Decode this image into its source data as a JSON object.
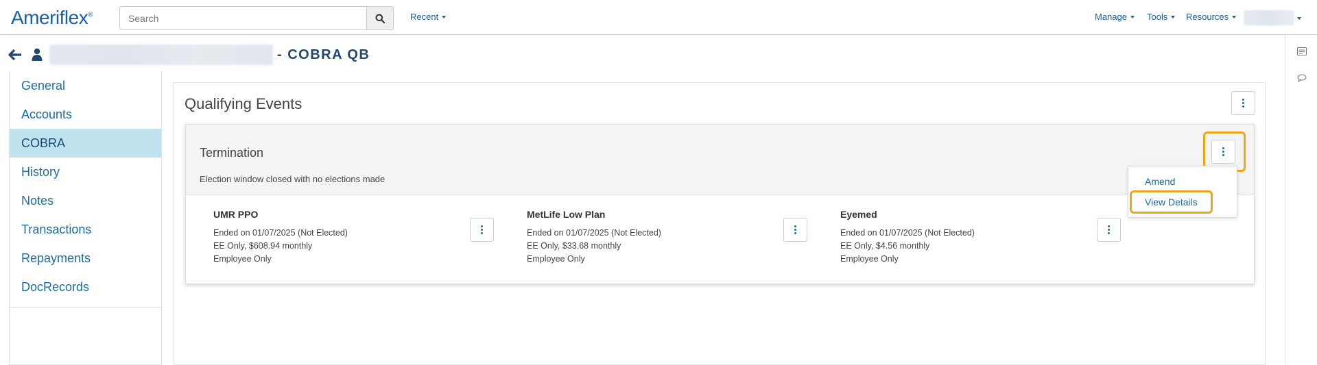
{
  "topnav": {
    "logo": "Ameriflex",
    "logo_mark": "®",
    "search_placeholder": "Search",
    "recent_label": "Recent",
    "manage_label": "Manage",
    "tools_label": "Tools",
    "resources_label": "Resources"
  },
  "header": {
    "title": "- COBRA QB"
  },
  "leftnav": {
    "items": [
      {
        "label": "General"
      },
      {
        "label": "Accounts"
      },
      {
        "label": "COBRA"
      },
      {
        "label": "History"
      },
      {
        "label": "Notes"
      },
      {
        "label": "Transactions"
      },
      {
        "label": "Repayments"
      },
      {
        "label": "DocRecords"
      }
    ],
    "active": "COBRA"
  },
  "main": {
    "section_title": "Qualifying Events",
    "event": {
      "title": "Termination",
      "subtitle": "Election window closed with no elections made",
      "menu": {
        "items": [
          {
            "label": "Amend"
          },
          {
            "label": "View Details"
          }
        ]
      }
    },
    "plans": [
      {
        "name": "UMR PPO",
        "status": "Ended on 01/07/2025 (Not Elected)",
        "rate": "EE Only, $608.94 monthly",
        "coverage": "Employee Only"
      },
      {
        "name": "MetLife Low Plan",
        "status": "Ended on 01/07/2025 (Not Elected)",
        "rate": "EE Only, $33.68 monthly",
        "coverage": "Employee Only"
      },
      {
        "name": "Eyemed",
        "status": "Ended on 01/07/2025 (Not Elected)",
        "rate": "EE Only, $4.56 monthly",
        "coverage": "Employee Only"
      }
    ]
  },
  "colors": {
    "brand": "#1a5fa8",
    "link": "#1a6da8",
    "active_nav": "#bfe3ee",
    "highlight": "#f0a418",
    "title": "#24476e"
  }
}
